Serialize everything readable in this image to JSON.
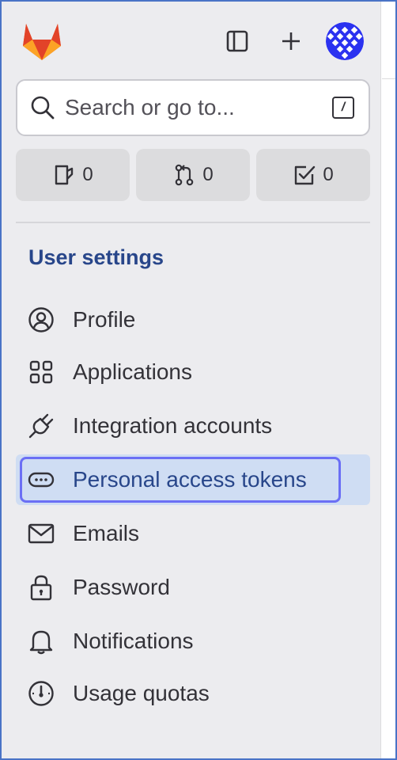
{
  "header": {
    "logo_icon": "gitlab-tanuki-icon",
    "sidebar_toggle_icon": "sidebar-toggle-icon",
    "create_icon": "plus-icon",
    "avatar_icon": "user-avatar"
  },
  "search": {
    "placeholder": "Search or go to...",
    "shortcut": "/"
  },
  "counters": [
    {
      "icon": "issues-icon",
      "count": "0"
    },
    {
      "icon": "merge-request-icon",
      "count": "0"
    },
    {
      "icon": "todo-icon",
      "count": "0"
    }
  ],
  "section": {
    "title": "User settings"
  },
  "nav": {
    "items": [
      {
        "label": "Profile",
        "icon": "profile-icon"
      },
      {
        "label": "Applications",
        "icon": "applications-icon"
      },
      {
        "label": "Integration accounts",
        "icon": "plug-icon"
      },
      {
        "label": "Personal access tokens",
        "icon": "token-icon",
        "active": true
      },
      {
        "label": "Emails",
        "icon": "mail-icon"
      },
      {
        "label": "Password",
        "icon": "lock-icon"
      },
      {
        "label": "Notifications",
        "icon": "bell-icon"
      },
      {
        "label": "Usage quotas",
        "icon": "gauge-icon"
      }
    ]
  },
  "colors": {
    "sidebar_bg": "#ececef",
    "accent": "#28468a",
    "active_bg": "#cfddf3",
    "focus": "#6b6ff5"
  }
}
